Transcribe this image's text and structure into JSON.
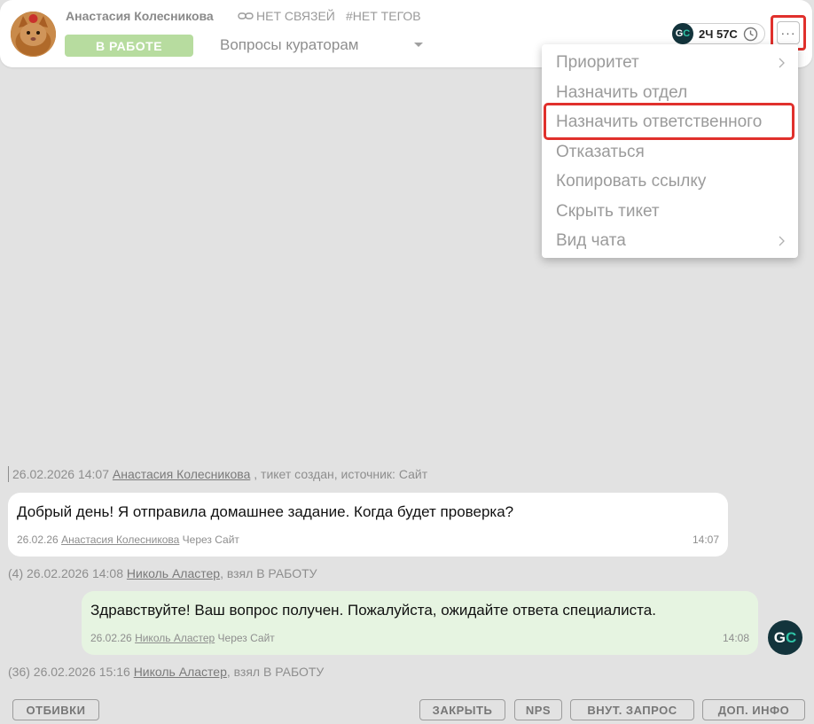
{
  "header": {
    "user_name": "Анастасия Колесникова",
    "links_label": "НЕТ СВЯЗЕЙ",
    "tags_label": "#НЕТ ТЕГОВ",
    "status": "В РАБОТЕ",
    "topic": "Вопросы кураторам",
    "timer_logo": {
      "g": "G",
      "c": "C"
    },
    "timer": "2Ч 57С",
    "more_label": "···"
  },
  "menu": {
    "items": [
      {
        "label": "Приоритет",
        "has_submenu": true
      },
      {
        "label": "Назначить отдел",
        "has_submenu": false
      },
      {
        "label": "Назначить ответственного",
        "has_submenu": false,
        "highlighted": true
      },
      {
        "label": "Отказаться",
        "has_submenu": false
      },
      {
        "label": "Копировать ссылку",
        "has_submenu": false
      },
      {
        "label": "Скрыть тикет",
        "has_submenu": false
      },
      {
        "label": "Вид чата",
        "has_submenu": true
      }
    ]
  },
  "chat": {
    "event_created": {
      "datetime": "26.02.2026 14:07",
      "author": "Анастасия Колесникова",
      "text": " , тикет создан, источник: Сайт"
    },
    "message_in": {
      "text": "Добрый день! Я отправила домашнее задание. Когда будет проверка?",
      "date": "26.02.26",
      "author": "Анастасия Колесникова",
      "via": " Через Сайт",
      "time": "14:07"
    },
    "event_taken_1": {
      "count": "(4)",
      "datetime": "26.02.2026 14:08",
      "author": "Николь Аластер",
      "text": ", взял В РАБОТУ"
    },
    "message_out": {
      "text": "Здравствуйте! Ваш вопрос получен. Пожалуйста, ожидайте ответа специалиста.",
      "date": "26.02.26",
      "author": "Николь Аластер",
      "via": " Через Сайт",
      "time": "14:08",
      "avatar": {
        "g": "G",
        "c": "C"
      }
    },
    "event_taken_2": {
      "count": "(36)",
      "datetime": "26.02.2026 15:16",
      "author": "Николь Аластер",
      "text": ", взял В РАБОТУ"
    }
  },
  "footer": {
    "buttons": [
      "ОТБИВКИ",
      "ЗАКРЫТЬ",
      "NPS",
      "ВНУТ. ЗАПРОС",
      "ДОП. ИНФО"
    ]
  },
  "colors": {
    "background": "#e2e2e2",
    "status_green": "#b7dc9f",
    "highlight_red": "#e0302c",
    "brand_dark": "#13343c",
    "brand_accent": "#2fc3a6",
    "outgoing_bubble": "#e6f4e1"
  }
}
